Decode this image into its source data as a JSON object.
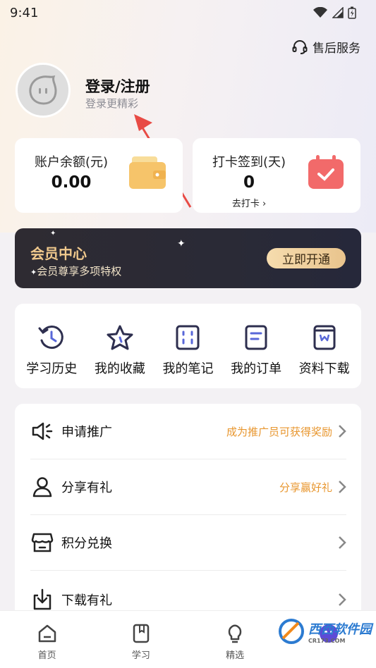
{
  "status_bar": {
    "time": "9:41"
  },
  "header": {
    "support_label": "售后服务"
  },
  "profile": {
    "title": "登录/注册",
    "subtitle": "登录更精彩"
  },
  "balance_card": {
    "label": "账户余额(元)",
    "value": "0.00"
  },
  "checkin_card": {
    "label": "打卡签到(天)",
    "value": "0",
    "action": "去打卡"
  },
  "vip": {
    "title": "会员中心",
    "subtitle": "会员尊享多项特权",
    "button": "立即开通"
  },
  "quick_actions": [
    {
      "label": "学习历史",
      "icon": "history-icon"
    },
    {
      "label": "我的收藏",
      "icon": "star-icon"
    },
    {
      "label": "我的笔记",
      "icon": "notes-icon"
    },
    {
      "label": "我的订单",
      "icon": "order-icon"
    },
    {
      "label": "资料下载",
      "icon": "book-download-icon"
    }
  ],
  "menu": [
    {
      "label": "申请推广",
      "hint": "成为推广员可获得奖励",
      "icon": "megaphone-icon"
    },
    {
      "label": "分享有礼",
      "hint": "分享赢好礼",
      "icon": "person-icon"
    },
    {
      "label": "积分兑换",
      "hint": "",
      "icon": "store-icon"
    },
    {
      "label": "下载有礼",
      "hint": "",
      "icon": "download-icon"
    }
  ],
  "tabbar": [
    {
      "label": "首页",
      "icon": "home-icon"
    },
    {
      "label": "学习",
      "icon": "book-icon"
    },
    {
      "label": "精选",
      "icon": "bulb-icon"
    },
    {
      "label": "",
      "icon": "profile-icon"
    }
  ],
  "watermark": {
    "text": "西西软件园",
    "sub": "CR173.COM"
  },
  "colors": {
    "accent_orange": "#e8962e",
    "vip_gold": "#f0c98d",
    "checkin_red": "#f26a6a",
    "wallet_yellow": "#f6c46a"
  }
}
